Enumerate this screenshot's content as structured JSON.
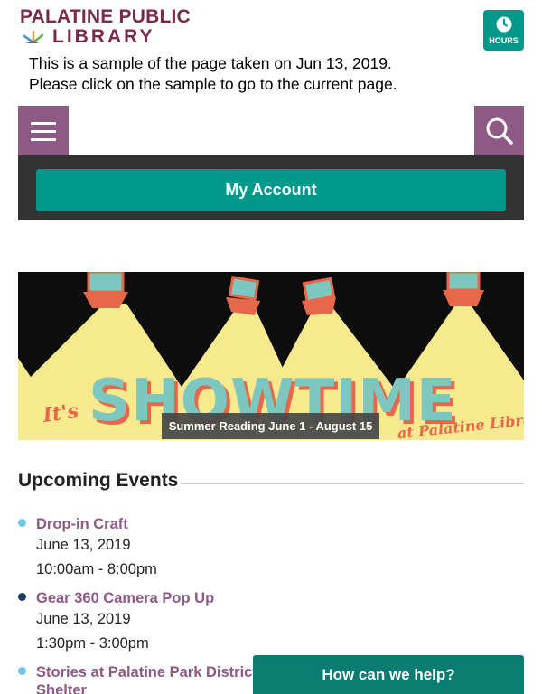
{
  "header": {
    "logo_line1": "PALATINE PUBLIC",
    "logo_line2": "LIBRARY",
    "hours_label": "HOURS",
    "hours_icon": "clock-icon"
  },
  "sample_notice": {
    "line1": "This is a sample of the page taken on Jun 13, 2019.",
    "line2": "Please click on the sample to go to the current page."
  },
  "nav": {
    "menu_icon": "hamburger-icon",
    "search_icon": "search-icon",
    "account_label": "My Account"
  },
  "banner": {
    "caption": "Summer Reading June 1 - August 15",
    "headline_small": "It's",
    "headline": "SHOWTIME",
    "subline": "at Palatine Library"
  },
  "events": {
    "heading": "Upcoming Events",
    "items": [
      {
        "title": "Drop-in Craft",
        "date": "June 13, 2019",
        "time": "10:00am - 8:00pm",
        "dot_color": "#6ec6ea"
      },
      {
        "title": "Gear 360 Camera Pop Up",
        "date": "June 13, 2019",
        "time": "1:30pm - 3:00pm",
        "dot_color": "#1f3a66"
      },
      {
        "title": "Stories at Palatine Park District",
        "title_line2": "Shelter",
        "dot_color": "#6ec6ea"
      }
    ]
  },
  "help": {
    "label": "How can we help?"
  },
  "colors": {
    "brand": "#7a2a4a",
    "purple": "#8c5a84",
    "teal": "#00988a",
    "dark_teal": "#0b7c71",
    "dark_bar": "#333333"
  }
}
